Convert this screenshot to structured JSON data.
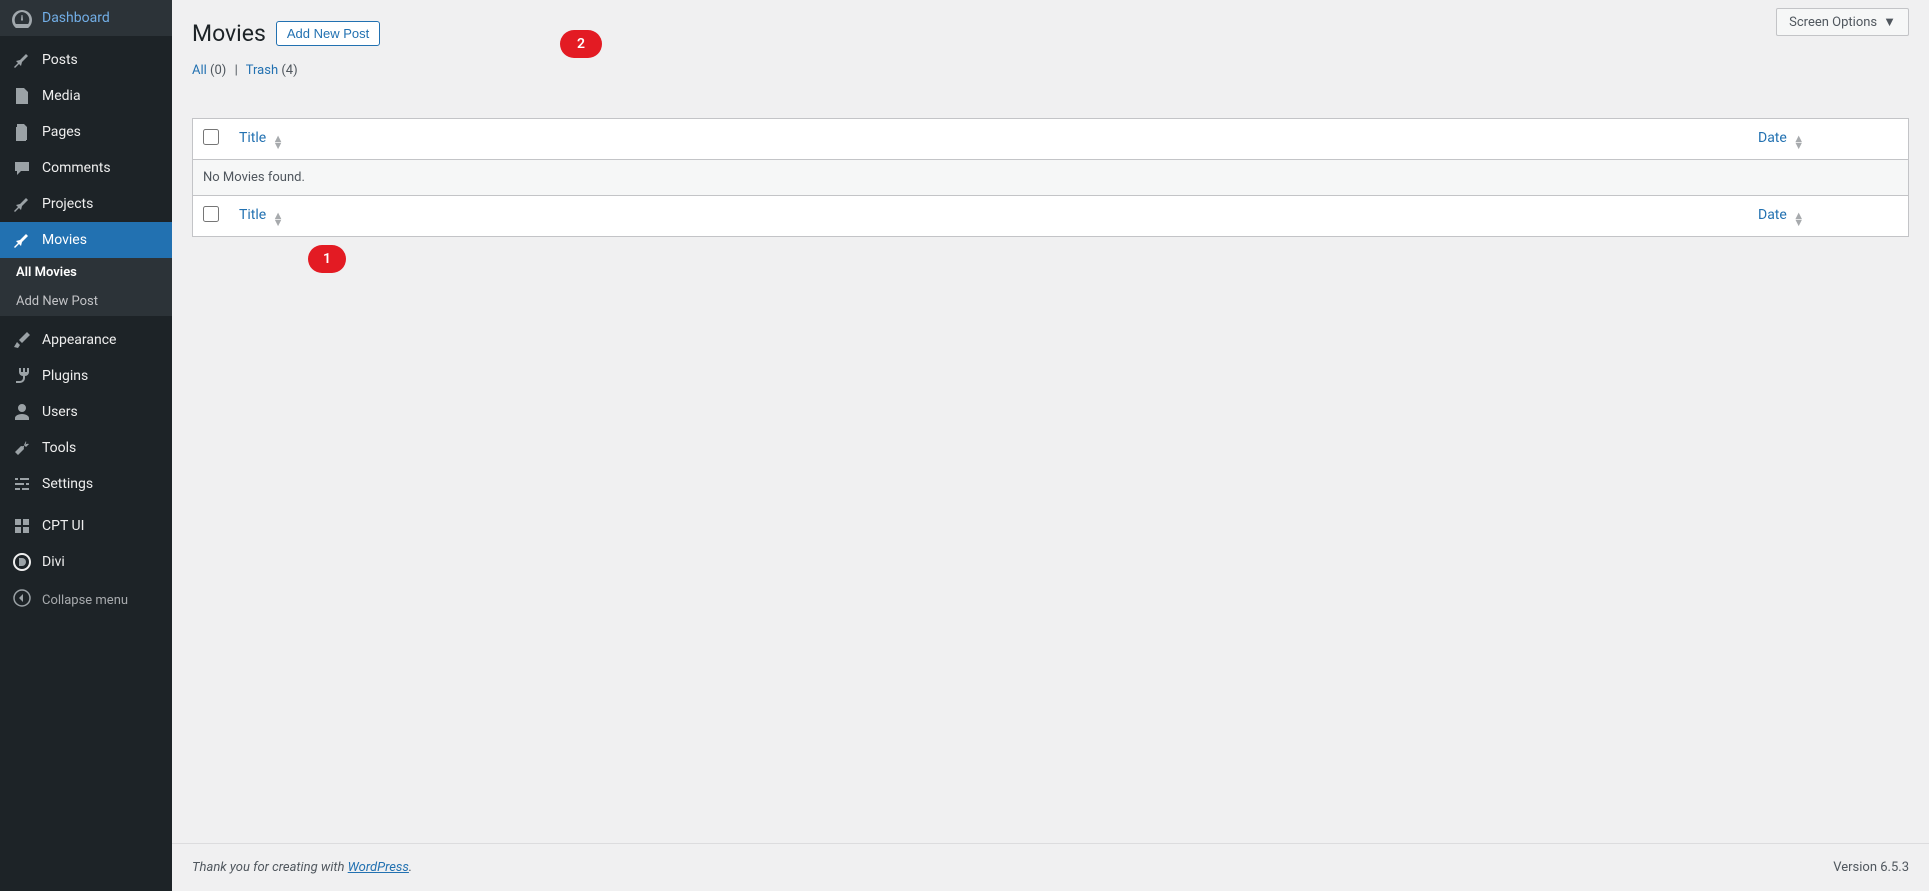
{
  "sidebar": {
    "items": [
      {
        "label": "Dashboard",
        "icon": "dashboard"
      },
      {
        "label": "Posts",
        "icon": "pin"
      },
      {
        "label": "Media",
        "icon": "media"
      },
      {
        "label": "Pages",
        "icon": "pages"
      },
      {
        "label": "Comments",
        "icon": "comments"
      },
      {
        "label": "Projects",
        "icon": "pin"
      },
      {
        "label": "Movies",
        "icon": "pin",
        "active": true
      },
      {
        "label": "Appearance",
        "icon": "brush"
      },
      {
        "label": "Plugins",
        "icon": "plug"
      },
      {
        "label": "Users",
        "icon": "user"
      },
      {
        "label": "Tools",
        "icon": "wrench"
      },
      {
        "label": "Settings",
        "icon": "sliders"
      },
      {
        "label": "CPT UI",
        "icon": "cpt"
      },
      {
        "label": "Divi",
        "icon": "divi"
      }
    ],
    "submenu": [
      {
        "label": "All Movies",
        "current": true
      },
      {
        "label": "Add New Post"
      }
    ],
    "collapse": "Collapse menu"
  },
  "header": {
    "screen_options": "Screen Options",
    "page_title": "Movies",
    "add_new": "Add New Post"
  },
  "filters": {
    "all_label": "All",
    "all_count": "(0)",
    "trash_label": "Trash",
    "trash_count": "(4)"
  },
  "table": {
    "col_title": "Title",
    "col_date": "Date",
    "empty_message": "No Movies found."
  },
  "footer": {
    "thank_you_pre": "Thank you for creating with ",
    "wordpress": "WordPress",
    "version": "Version 6.5.3"
  },
  "annotations": {
    "one": "1",
    "two": "2"
  }
}
